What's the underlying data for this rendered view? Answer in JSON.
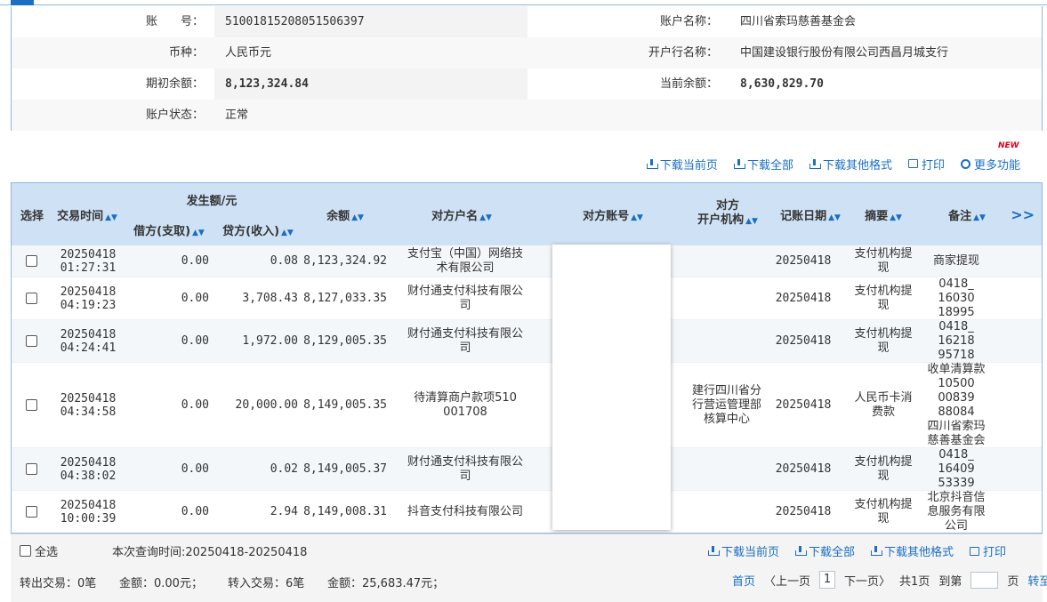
{
  "account_info": {
    "account_no_label": "账　　号：",
    "account_no": "51001815208051506397",
    "account_name_label": "账户名称：",
    "account_name": "四川省索玛慈善基金会",
    "currency_label": "币种：",
    "currency": "人民币元",
    "bank_label": "开户行名称：",
    "bank": "中国建设银行股份有限公司西昌月城支行",
    "opening_balance_label": "期初余额：",
    "opening_balance": "8,123,324.84",
    "current_balance_label": "当前余额：",
    "current_balance": "8,630,829.70",
    "status_label": "账户状态：",
    "status": "正常"
  },
  "toolbar": {
    "download_page": "下载当前页",
    "download_all": "下载全部",
    "download_other": "下载其他格式",
    "print": "打印",
    "more": "更多功能",
    "new_badge": "NEW"
  },
  "table": {
    "headers": {
      "select": "选择",
      "time": "交易时间",
      "amount_group": "发生额/元",
      "debit": "借方(支取)",
      "credit": "贷方(收入)",
      "balance": "余额",
      "counterparty": "对方户名",
      "counter_account": "对方账号",
      "counter_org_1": "对方",
      "counter_org_2": "开户机构",
      "post_date": "记账日期",
      "summary": "摘要",
      "remark": "备注",
      "more": ">>"
    },
    "rows": [
      {
        "date": "20250418",
        "time": "01:27:31",
        "debit": "0.00",
        "credit": "0.08",
        "balance": "8,123,324.92",
        "party": [
          "支付宝（中国）网络技",
          "术有限公司"
        ],
        "org": [],
        "post": "20250418",
        "summary": [
          "支付机构提",
          "现"
        ],
        "remark": [
          "商家提现"
        ]
      },
      {
        "date": "20250418",
        "time": "04:19:23",
        "debit": "0.00",
        "credit": "3,708.43",
        "balance": "8,127,033.35",
        "party": [
          "财付通支付科技有限公",
          "司"
        ],
        "org": [],
        "post": "20250418",
        "summary": [
          "支付机构提",
          "现"
        ],
        "remark": [
          "0418_",
          "16030",
          "18995"
        ]
      },
      {
        "date": "20250418",
        "time": "04:24:41",
        "debit": "0.00",
        "credit": "1,972.00",
        "balance": "8,129,005.35",
        "party": [
          "财付通支付科技有限公",
          "司"
        ],
        "org": [],
        "post": "20250418",
        "summary": [
          "支付机构提",
          "现"
        ],
        "remark": [
          "0418_",
          "16218",
          "95718"
        ]
      },
      {
        "date": "20250418",
        "time": "04:34:58",
        "debit": "0.00",
        "credit": "20,000.00",
        "balance": "8,149,005.35",
        "party": [
          "待清算商户款项510",
          "001708"
        ],
        "org": [
          "建行四川省分",
          "行营运管理部",
          "核算中心"
        ],
        "post": "20250418",
        "summary": [
          "人民币卡消",
          "费款"
        ],
        "remark": [
          "收单清算款",
          "10500",
          "00839",
          "88084",
          "四川省索玛",
          "慈善基金会"
        ]
      },
      {
        "date": "20250418",
        "time": "04:38:02",
        "debit": "0.00",
        "credit": "0.02",
        "balance": "8,149,005.37",
        "party": [
          "财付通支付科技有限公",
          "司"
        ],
        "org": [],
        "post": "20250418",
        "summary": [
          "支付机构提",
          "现"
        ],
        "remark": [
          "0418_",
          "16409",
          "53339"
        ]
      },
      {
        "date": "20250418",
        "time": "10:00:39",
        "debit": "0.00",
        "credit": "2.94",
        "balance": "8,149,008.31",
        "party": [
          "抖音支付科技有限公司"
        ],
        "org": [],
        "post": "20250418",
        "summary": [
          "支付机构提",
          "现"
        ],
        "remark": [
          "北京抖音信",
          "息服务有限",
          "公司"
        ]
      }
    ]
  },
  "footer": {
    "select_all": "全选",
    "query_time": "本次查询时间:20250418-20250418",
    "download_page": "下载当前页",
    "download_all": "下载全部",
    "download_other": "下载其他格式",
    "print": "打印",
    "out_txn": "转出交易：0笔",
    "out_amount": "金额：0.00元；",
    "in_txn": "转入交易：6笔",
    "in_amount": "金额：25,683.47元；",
    "first": "首页",
    "prev": "〈上一页",
    "page": "1",
    "next": "下一页〉",
    "total": "共1页",
    "goto_label": "到第",
    "page_unit": "页",
    "go": "转至"
  }
}
